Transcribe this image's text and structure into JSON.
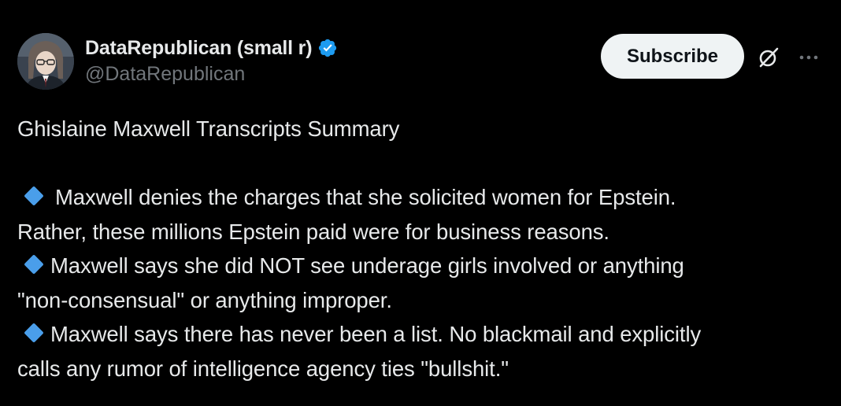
{
  "author": {
    "display_name": "DataRepublican (small r)",
    "handle": "@DataRepublican",
    "verified": true,
    "verified_color": "#1d9bf0"
  },
  "actions": {
    "subscribe_label": "Subscribe",
    "grok_icon": "grok-icon",
    "more_icon": "more-icon"
  },
  "post": {
    "title": "Ghislaine Maxwell Transcripts Summary",
    "bullet_icon": "blue-diamond-icon",
    "bullet_color": "#4a9eea",
    "bullets": [
      {
        "line1": "Maxwell denies the charges that she solicited women for Epstein.",
        "line2": "Rather, these millions Epstein paid were for business reasons."
      },
      {
        "line1": "Maxwell says she did NOT see underage girls involved or anything",
        "line2": "\"non-consensual\" or anything improper."
      },
      {
        "line1": "Maxwell says there has never been a list. No blackmail and explicitly",
        "line2": "calls any rumor of intelligence agency ties \"bullshit.\""
      }
    ]
  }
}
